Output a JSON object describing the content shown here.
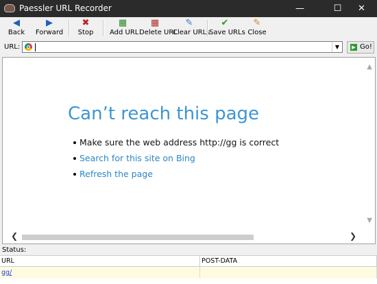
{
  "window": {
    "title": "Paessler URL Recorder",
    "minimize": "—",
    "maximize": "☐",
    "close": "✕"
  },
  "toolbar": {
    "back": "Back",
    "forward": "Forward",
    "stop": "Stop",
    "add_url": "Add URL",
    "delete_url": "Delete URL",
    "clear_urls": "Clear URLs",
    "save_urls": "Save URLs",
    "close": "Close"
  },
  "urlbar": {
    "label": "URL:",
    "value": "",
    "go_label": "Go!"
  },
  "page": {
    "title": "Can’t reach this page",
    "bullets": [
      "Make sure the web address http://gg is correct",
      "Search for this site on Bing",
      "Refresh the page"
    ]
  },
  "status": {
    "label": "Status:"
  },
  "table": {
    "columns": [
      "URL",
      "POST-DATA"
    ],
    "rows": [
      {
        "url": "gg/",
        "post_data": ""
      }
    ]
  }
}
